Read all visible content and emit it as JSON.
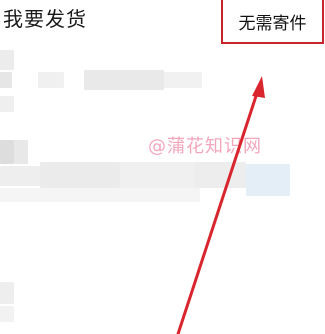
{
  "header": {
    "title": "我要发货",
    "no_ship_button_label": "无需寄件"
  },
  "watermark": {
    "text": "@蒲花知识网"
  },
  "colors": {
    "highlight_border": "#c8252c",
    "arrow": "#d9252e",
    "watermark": "#f2a6bc"
  }
}
